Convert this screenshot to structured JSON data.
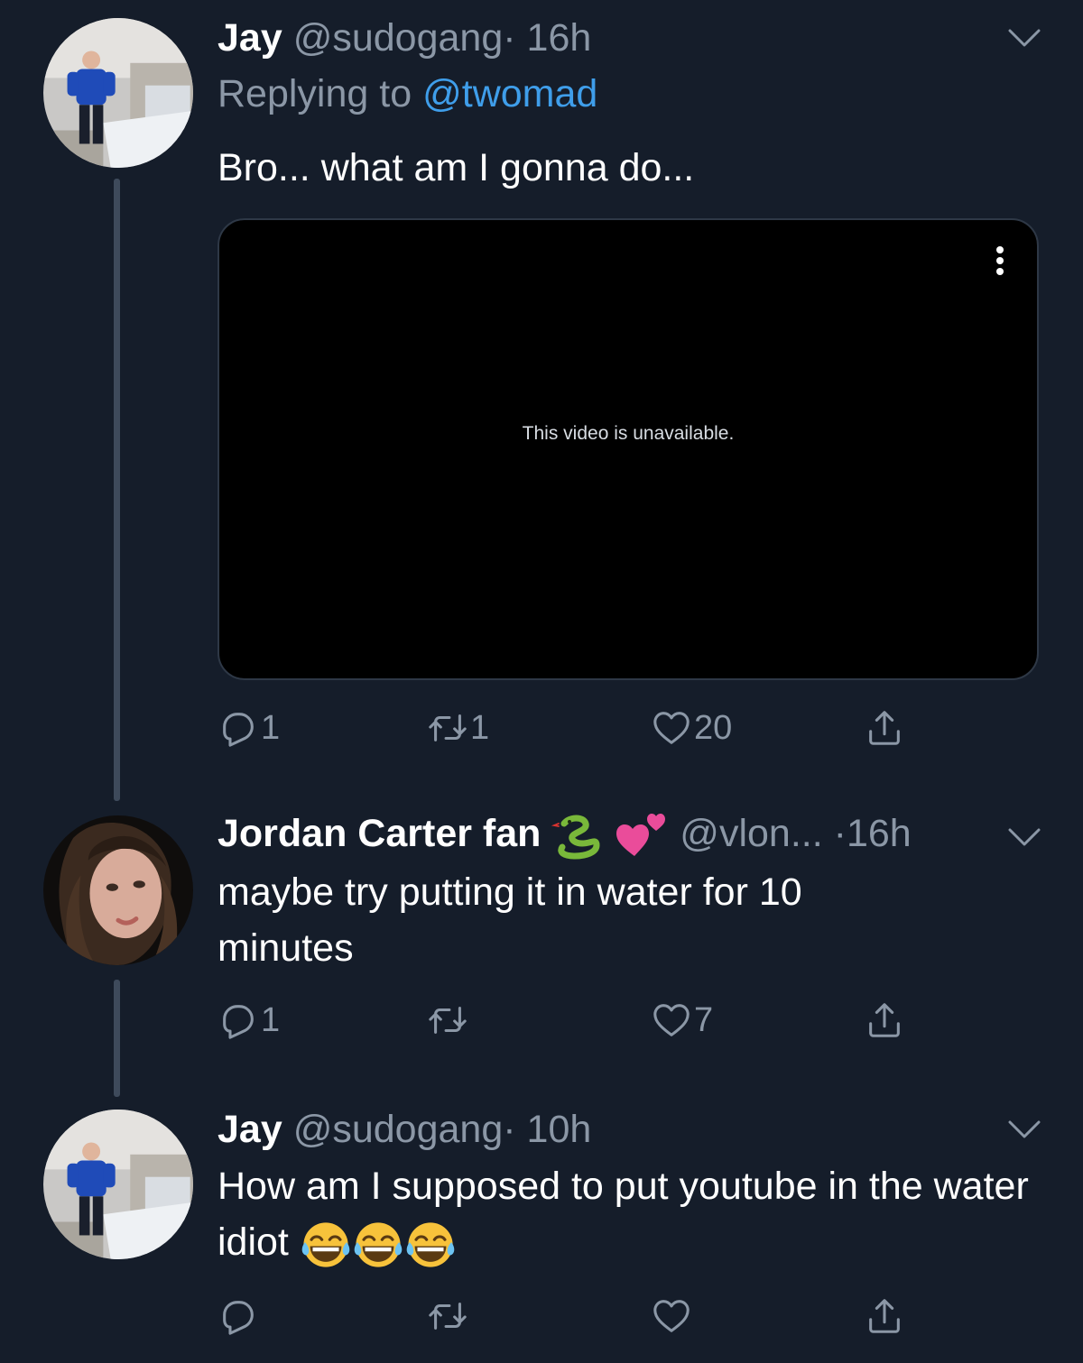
{
  "tweets": [
    {
      "name": "Jay",
      "handle": "@sudogang",
      "sep": "·",
      "time": "16h",
      "replying_prefix": "Replying to",
      "replying_handle": "@twomad",
      "text": "Bro... what am I gonna do...",
      "video_message": "This video is unavailable.",
      "replies": "1",
      "retweets": "1",
      "likes": "20"
    },
    {
      "name": "Jordan Carter fan",
      "name_emojis": [
        "snake-emoji",
        "two-hearts-emoji"
      ],
      "handle": "@vlon...",
      "sep": "·",
      "time": "16h",
      "text": "maybe try putting it in water for 10 minutes",
      "replies": "1",
      "retweets": "",
      "likes": "7"
    },
    {
      "name": "Jay",
      "handle": "@sudogang",
      "sep": "·",
      "time": "10h",
      "text": "How am I supposed to put youtube in the water idiot",
      "text_emojis": [
        "laughing-tears-emoji",
        "laughing-tears-emoji",
        "laughing-tears-emoji"
      ],
      "replies": "",
      "retweets": "",
      "likes": ""
    }
  ],
  "colors": {
    "background": "#151d2a",
    "text": "#ffffff",
    "secondary": "#8b97a6",
    "link": "#3f9eea",
    "thread_line": "#3e4a5b"
  }
}
